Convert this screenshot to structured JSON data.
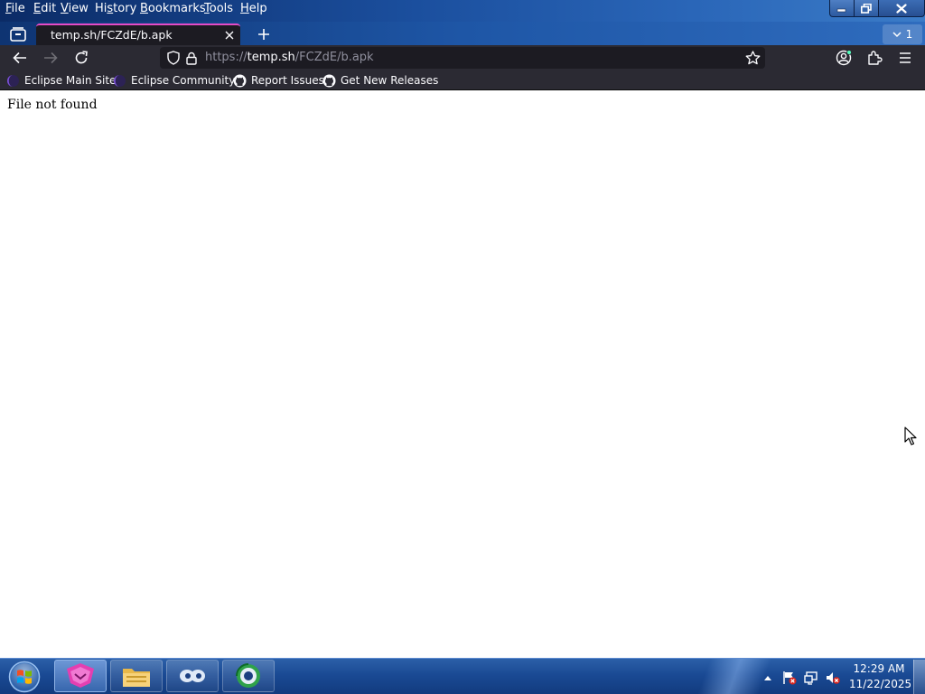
{
  "menu": {
    "file": {
      "first": "F",
      "rest": "ile"
    },
    "edit": {
      "first": "E",
      "rest": "dit"
    },
    "view": {
      "first": "V",
      "rest": "iew"
    },
    "history": {
      "before": "Hi",
      "underlined": "s",
      "after": "tory"
    },
    "bookmarks": {
      "first": "B",
      "rest": "ookmarks"
    },
    "tools": {
      "first": "T",
      "rest": "ools"
    },
    "help": {
      "first": "H",
      "rest": "elp"
    }
  },
  "tabs": {
    "active_title": "temp.sh/FCZdE/b.apk",
    "count": "1"
  },
  "urlbar": {
    "scheme": "https://",
    "host": "temp.sh",
    "path": "/FCZdE/b.apk"
  },
  "bookmarks": [
    {
      "label": "Eclipse Main Site",
      "icon": "eclipse-icon"
    },
    {
      "label": "Eclipse Community",
      "icon": "eclipse-icon"
    },
    {
      "label": "Report Issues",
      "icon": "github-icon"
    },
    {
      "label": "Get New Releases",
      "icon": "github-icon"
    }
  ],
  "page": {
    "message": "File not found"
  },
  "taskbar": {
    "time": "12:29 AM",
    "date": "11/22/2025",
    "apps": [
      {
        "name": "browser-app",
        "icon": "fox-icon",
        "active": true
      },
      {
        "name": "file-explorer",
        "icon": "folder-icon",
        "active": false
      },
      {
        "name": "viewer-app",
        "icon": "eyes-icon",
        "active": false
      },
      {
        "name": "network-app",
        "icon": "globe-icon",
        "active": false
      }
    ]
  },
  "colors": {
    "tab_accent": "#e44bc7",
    "toolbar_bg": "#2b2a33",
    "url_field_bg": "#1c1b22",
    "taskbar_blue": "#1a4a94"
  }
}
